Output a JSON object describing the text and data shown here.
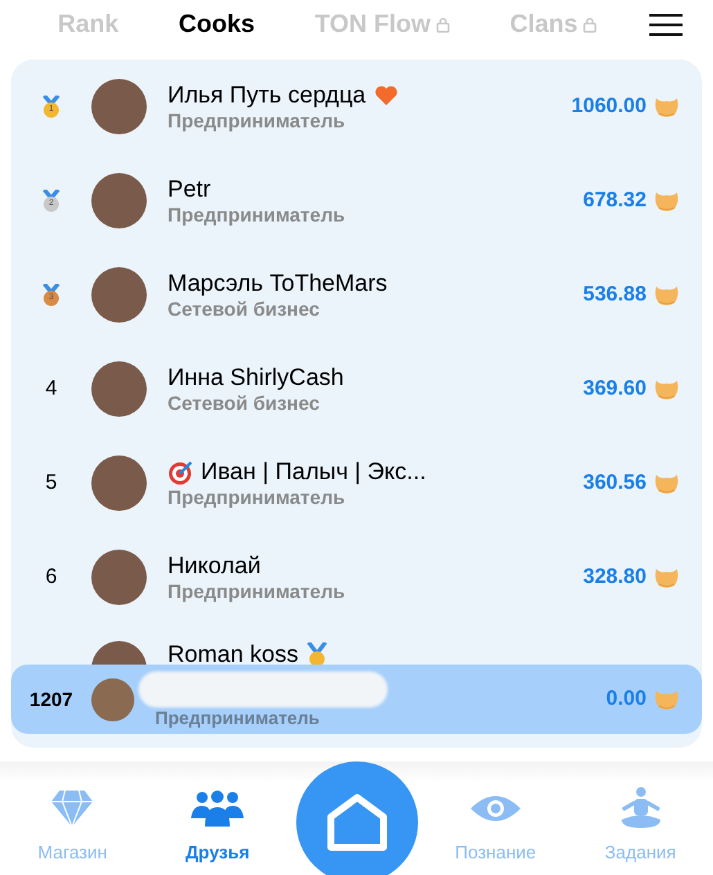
{
  "tabs": [
    {
      "label": "Rank",
      "selected": false,
      "locked": false
    },
    {
      "label": "Cooks",
      "selected": true,
      "locked": false
    },
    {
      "label": "TON Flow",
      "selected": false,
      "locked": true
    },
    {
      "label": "Clans",
      "selected": false,
      "locked": true
    }
  ],
  "leaderboard": [
    {
      "rank": "1",
      "kind": "medal",
      "color": "#f2b630",
      "name": "Илья Путь сердца",
      "badge": {
        "kind": "heart"
      },
      "subtitle": "Предприниматель",
      "score": "1060.00"
    },
    {
      "rank": "2",
      "kind": "medal",
      "color": "#c8c8c8",
      "name": "Petr",
      "subtitle": "Предприниматель",
      "score": "678.32"
    },
    {
      "rank": "3",
      "kind": "medal",
      "color": "#d98a45",
      "name": "Марсэль ToTheMars",
      "subtitle": "Сетевой бизнес",
      "score": "536.88"
    },
    {
      "rank": "4",
      "kind": "number",
      "name": "Инна ShirlyCash",
      "subtitle": "Сетевой бизнес",
      "score": "369.60"
    },
    {
      "rank": "5",
      "kind": "number",
      "name": "Иван | Палыч | Экс...",
      "badge": {
        "kind": "target"
      },
      "subtitle": "Предприниматель",
      "score": "360.56"
    },
    {
      "rank": "6",
      "kind": "number",
      "name": "Николай",
      "subtitle": "Предприниматель",
      "score": "328.80"
    },
    {
      "kind": "partial",
      "name": "Roman koss",
      "badge": {
        "kind": "medal"
      }
    }
  ],
  "current_user": {
    "rank": "1207",
    "subtitle": "Предприниматель",
    "score": "0.00"
  },
  "bottom_nav": [
    {
      "label": "Магазин",
      "kind": "diamond",
      "selected": false
    },
    {
      "label": "Друзья",
      "kind": "friends",
      "selected": true
    },
    {
      "kind": "home"
    },
    {
      "label": "Познание",
      "kind": "eye",
      "selected": false
    },
    {
      "label": "Задания",
      "kind": "meditation",
      "selected": false
    }
  ]
}
